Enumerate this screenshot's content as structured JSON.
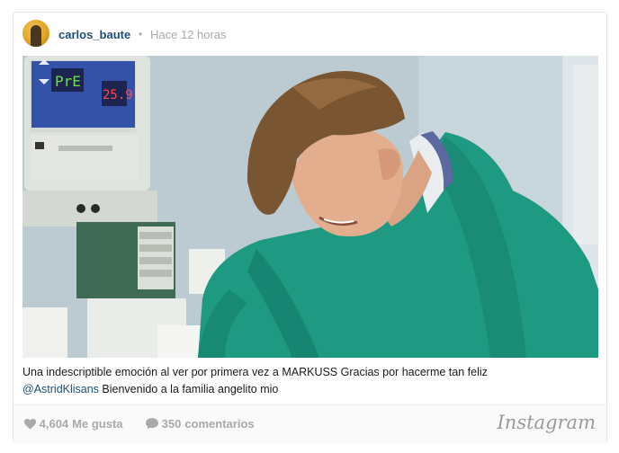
{
  "post": {
    "username": "carlos_baute",
    "separator": "•",
    "time": "Hace 12 horas",
    "caption_text": "Una indescriptible emoción al ver por primera vez a MARKUSS Gracias por hacerme tan feliz",
    "caption_mention": "@AstridKlisans",
    "caption_rest": " Bienvenido a la familia angelito mio",
    "monitor_left_display": "PrE",
    "monitor_right_display": "25.9"
  },
  "footer": {
    "likes": "4,604",
    "likes_label": "Me gusta",
    "comments": "350",
    "comments_label": "comentarios",
    "brand": "Instagram"
  },
  "colors": {
    "link": "#1e4e78",
    "muted": "#a9a9a9",
    "gown": "#1f9a82",
    "display_bg": "#2a3d8c",
    "display_green": "#6ee04a",
    "display_red": "#ff4a4a"
  },
  "icons": {
    "like": "heart-icon",
    "comment": "comment-bubble-icon"
  }
}
